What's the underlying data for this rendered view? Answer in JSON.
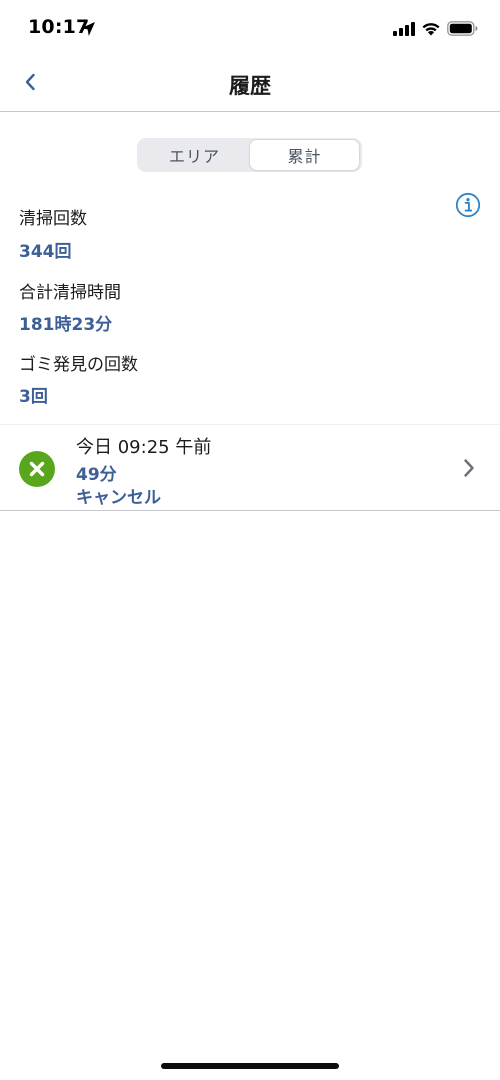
{
  "status_bar": {
    "time": "10:17"
  },
  "nav": {
    "title": "履歴",
    "back_icon": "chevron-left-icon"
  },
  "segments": {
    "left_label": "エリア",
    "right_label": "累計",
    "selected": "累計"
  },
  "stats": {
    "cleanings_label": "清掃回数",
    "cleanings_value": "344回",
    "total_time_label": "合計清掃時間",
    "total_time_value": "181時23分",
    "dirt_found_label": "ゴミ発見の回数",
    "dirt_found_value": "3回"
  },
  "history": [
    {
      "date": "今日 09:25 午前",
      "duration": "49分",
      "status": "キャンセル",
      "status_icon": "close-circle-icon"
    }
  ],
  "colors": {
    "accent_text": "#3d5f97",
    "info_icon": "#2f83c7",
    "cancel_badge": "#5aa51e"
  }
}
